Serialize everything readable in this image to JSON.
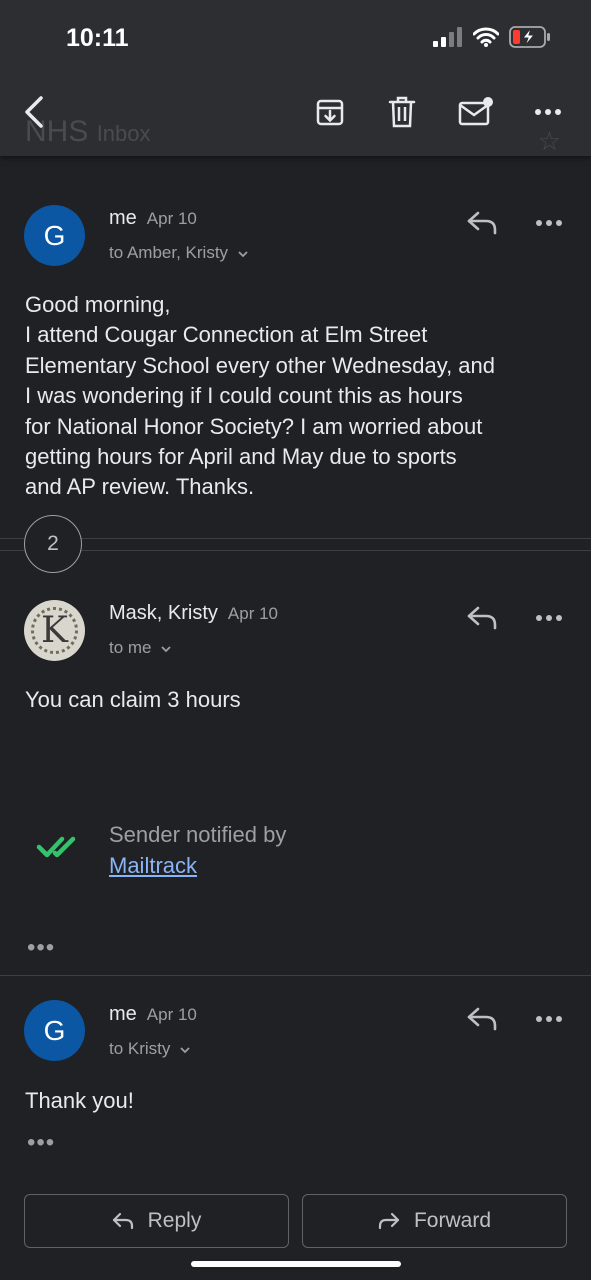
{
  "status_bar": {
    "time": "10:11"
  },
  "header": {
    "subject": "NHS",
    "label": "Inbox"
  },
  "messages": [
    {
      "avatar_letter": "G",
      "sender": "me",
      "date": "Apr 10",
      "to": "to Amber, Kristy",
      "body": [
        "Good morning,",
        "I attend Cougar Connection at Elm Street",
        "Elementary School every other Wednesday, and",
        "I was wondering if I could count this as hours",
        "for National Honor Society? I am worried about",
        "getting hours for April and May due to sports",
        "and AP review. Thanks."
      ]
    },
    {
      "avatar_letter": "K",
      "sender": "Mask, Kristy",
      "date": "Apr 10",
      "to": "to me",
      "body": [
        "You can claim 3 hours"
      ]
    },
    {
      "avatar_letter": "G",
      "sender": "me",
      "date": "Apr 10",
      "to": "to Kristy",
      "body": [
        "Thank you!"
      ]
    }
  ],
  "collapsed_count": "2",
  "mailtrack": {
    "text": "Sender notified by",
    "link": "Mailtrack"
  },
  "ellipsis": "•••",
  "actions": {
    "reply": "Reply",
    "forward": "Forward"
  },
  "colors": {
    "avatar_blue": "#0b57a4",
    "mailtrack_green": "#34c36b",
    "link_blue": "#8ab4f8"
  }
}
